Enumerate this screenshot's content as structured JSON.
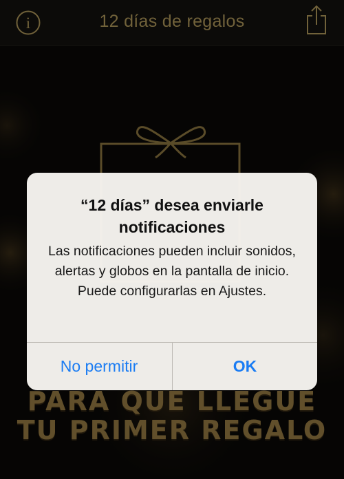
{
  "nav": {
    "title": "12 días de regalos",
    "info_icon": "info-circle-icon",
    "share_icon": "share-icon"
  },
  "background": {
    "promo_line_1": "PARA QUE LLEGUE",
    "promo_line_2": "TU PRIMER REGALO",
    "gift_icon": "gift-box-icon"
  },
  "alert": {
    "title": "“12 días” desea enviarle notificaciones",
    "message": "Las notificaciones pueden incluir sonidos, alertas y globos en la pantalla de inicio. Puede configurarlas en Ajustes.",
    "deny_label": "No permitir",
    "ok_label": "OK"
  },
  "colors": {
    "gold": "#c3a964",
    "ios_blue": "#1a7cf3",
    "background": "#0c0a08"
  }
}
